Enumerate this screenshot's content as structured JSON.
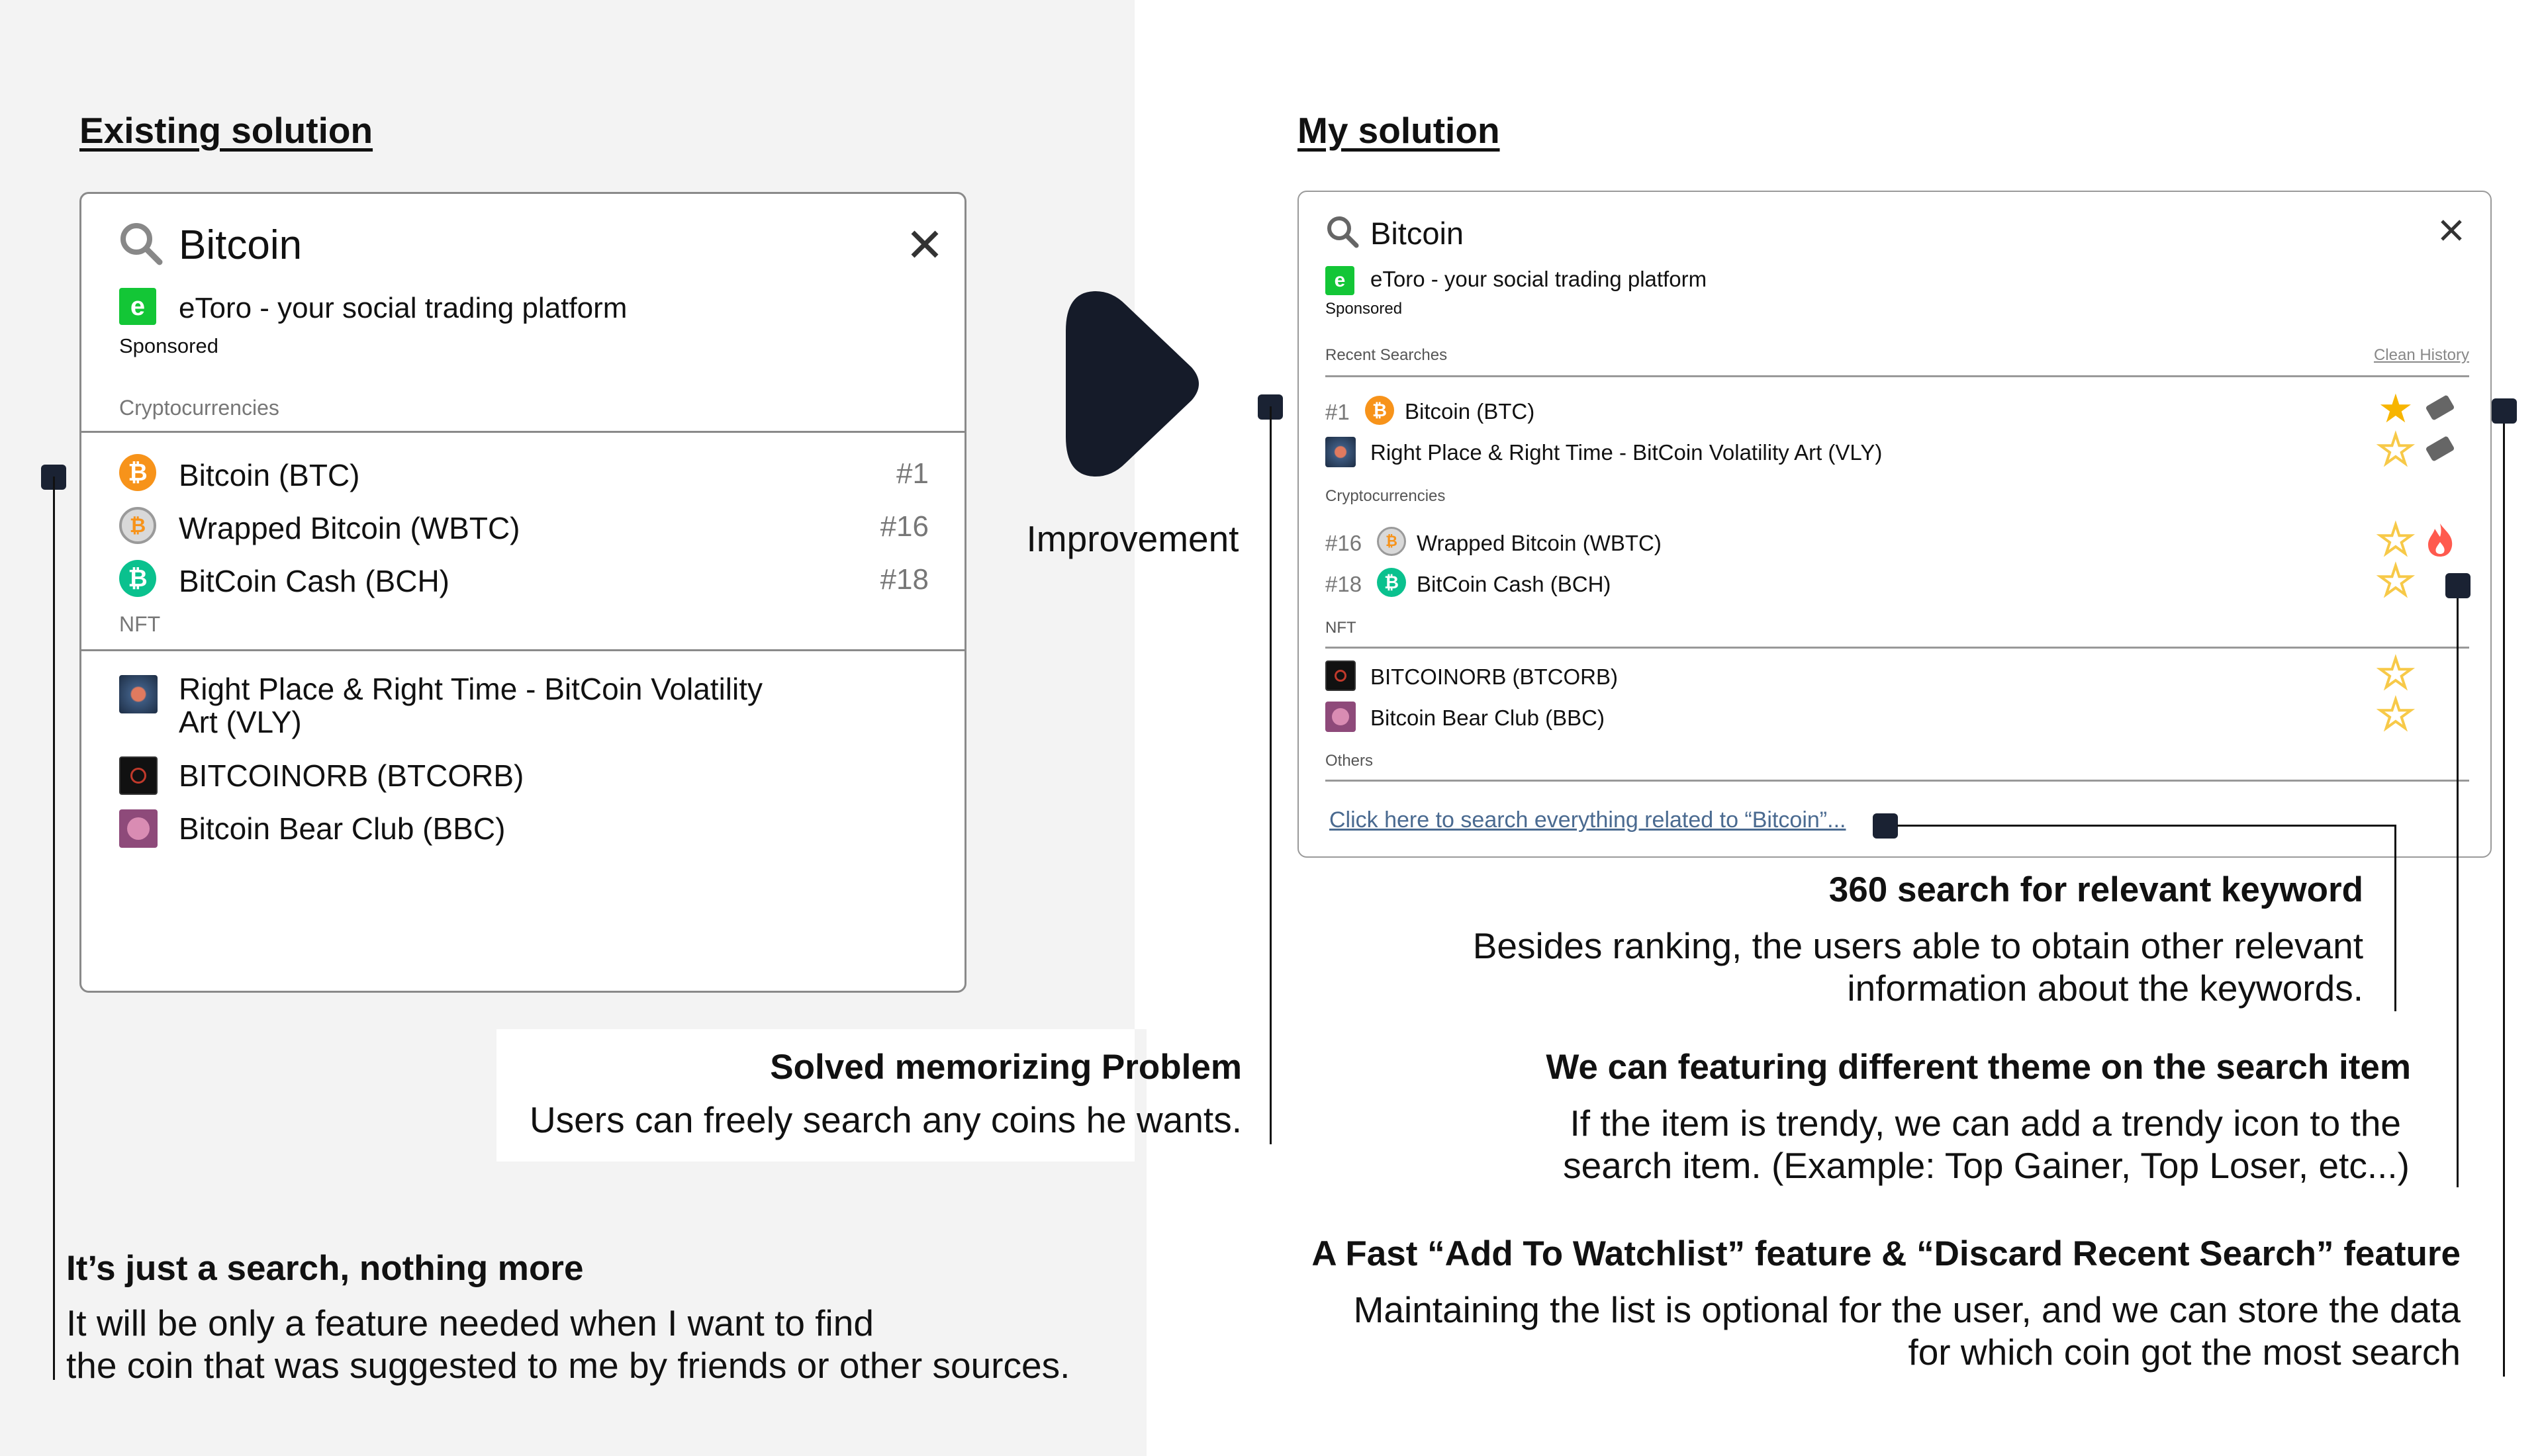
{
  "left": {
    "heading": "Existing solution",
    "search": {
      "value": "Bitcoin"
    },
    "sponsor": {
      "name": "eToro - your social trading platform",
      "label": "Sponsored"
    },
    "sections": {
      "crypto": "Cryptocurrencies",
      "nft": "NFT"
    },
    "crypto_items": [
      {
        "name": "Bitcoin (BTC)",
        "rank": "#1"
      },
      {
        "name": "Wrapped Bitcoin (WBTC)",
        "rank": "#16"
      },
      {
        "name": "BitCoin Cash (BCH)",
        "rank": "#18"
      }
    ],
    "nft_items": [
      {
        "name": "Right Place & Right Time - BitCoin Volatility Art (VLY)"
      },
      {
        "name": "BITCOINORB (BTCORB)"
      },
      {
        "name": "Bitcoin Bear Club (BBC)"
      }
    ]
  },
  "arrow_label": "Improvement",
  "right": {
    "heading": "My solution",
    "search": {
      "value": "Bitcoin"
    },
    "sponsor": {
      "name": "eToro - your social trading platform",
      "label": "Sponsored"
    },
    "recent_label": "Recent Searches",
    "clean_history": "Clean History",
    "recent_items": [
      {
        "rank": "#1",
        "name": "Bitcoin (BTC)"
      },
      {
        "rank": "",
        "name": "Right Place & Right Time - BitCoin Volatility Art (VLY)"
      }
    ],
    "crypto_label": "Cryptocurrencies",
    "crypto_items": [
      {
        "rank": "#16",
        "name": "Wrapped Bitcoin (WBTC)"
      },
      {
        "rank": "#18",
        "name": "BitCoin Cash (BCH)"
      }
    ],
    "nft_label": "NFT",
    "nft_items": [
      {
        "name": "BITCOINORB (BTCORB)"
      },
      {
        "name": "Bitcoin Bear Club (BBC)"
      }
    ],
    "others_label": "Others",
    "others_link": "Click here to search everything related to “Bitcoin”..."
  },
  "annotations": {
    "memorizing": {
      "title": "Solved memorizing Problem",
      "body": "Users can freely search any coins he wants."
    },
    "just_search": {
      "title": "It’s just a search, nothing more",
      "line1": "It will be only a feature needed when I want to find",
      "line2": "the coin that was suggested to me by friends or other sources."
    },
    "search360": {
      "title": "360 search for relevant keyword",
      "line1": "Besides ranking, the users able to obtain other relevant",
      "line2": "information about the keywords."
    },
    "theme": {
      "title": "We can featuring different theme on the search item",
      "line1": "If the item is trendy, we can add a trendy icon to the",
      "line2": "search item. (Example: Top Gainer, Top Loser, etc...)"
    },
    "watchlist": {
      "title": "A Fast “Add To Watchlist” feature & “Discard Recent Search” feature",
      "line1": "Maintaining the list is optional for the user, and we can store the data",
      "line2": "for which coin got the most search"
    }
  },
  "colors": {
    "bitcoin": "#f7931a",
    "wbtc": "#a0a0a0",
    "bch": "#0ac18e",
    "etoro": "#13c636",
    "star": "#f7b500",
    "trendy": "#ff5a4e",
    "marker": "#1a2233"
  }
}
